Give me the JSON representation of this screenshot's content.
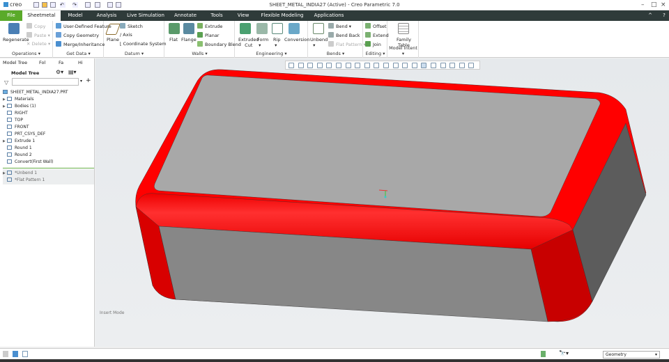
{
  "app": {
    "logo": "creo",
    "title": "SHEET_METAL_INDIA27 (Active) - Creo Parametric 7.0",
    "accent": "#5aaa2a",
    "tabbar_color": "#2f3b3a"
  },
  "tabs": [
    "File",
    "Sheetmetal",
    "Model",
    "Analysis",
    "Live Simulation",
    "Annotate",
    "Tools",
    "View",
    "Flexible Modeling",
    "Applications"
  ],
  "active_tab": "Sheetmetal",
  "ribbon": {
    "operations": {
      "label": "Operations",
      "regenerate": "Regenerate",
      "copy": "Copy",
      "paste": "Paste",
      "delete": "Delete"
    },
    "get_data": {
      "label": "Get Data",
      "udf": "User-Defined Feature",
      "copy_geometry": "Copy Geometry",
      "merge": "Merge/Inheritance"
    },
    "datum": {
      "label": "Datum",
      "plane": "Plane",
      "sketch": "Sketch",
      "axis": "Axis",
      "csys": "Coordinate System"
    },
    "walls": {
      "label": "Walls",
      "flat": "Flat",
      "flange": "Flange",
      "extrude": "Extrude",
      "planar": "Planar",
      "boundary_blend": "Boundary Blend"
    },
    "engineering": {
      "label": "Engineering",
      "extruded_cut_1": "Extruded",
      "extruded_cut_2": "Cut",
      "form": "Form",
      "rip": "Rip",
      "conversion": "Conversion"
    },
    "bends": {
      "label": "Bends",
      "unbend": "Unbend",
      "bend": "Bend",
      "bend_back": "Bend Back",
      "flat_pattern": "Flat Pattern"
    },
    "editing": {
      "label": "Editing",
      "offset": "Offset",
      "extend": "Extend",
      "join": "Join"
    },
    "model_intent": {
      "label": "Model Intent",
      "family_1": "Family",
      "family_2": "Table"
    }
  },
  "left_panel": {
    "tabs": [
      "Model Tree",
      "Fol",
      "Fa",
      "Hi"
    ],
    "header": "Model Tree",
    "search_placeholder": "",
    "root": "SHEET_METAL_INDIA27.PRT",
    "items": [
      {
        "label": "Materials",
        "expandable": true
      },
      {
        "label": "Bodies (1)",
        "expandable": true
      },
      {
        "label": "RIGHT",
        "expandable": false
      },
      {
        "label": "TOP",
        "expandable": false
      },
      {
        "label": "FRONT",
        "expandable": false
      },
      {
        "label": "PRT_CSYS_DEF",
        "expandable": false
      },
      {
        "label": "Extrude 1",
        "expandable": true
      },
      {
        "label": "Round 1",
        "expandable": false
      },
      {
        "label": "Round 2",
        "expandable": false
      },
      {
        "label": "Convert(First Wall)",
        "expandable": false
      }
    ],
    "suppressed": [
      {
        "label": "*Unbend 1",
        "expandable": true
      },
      {
        "label": "*Flat Pattern 1",
        "expandable": false
      }
    ]
  },
  "viewport": {
    "mode": "Insert Mode",
    "model_color": "#ff0000",
    "face_color": "#a8a8a8"
  },
  "status": {
    "filter": "Geometry"
  }
}
